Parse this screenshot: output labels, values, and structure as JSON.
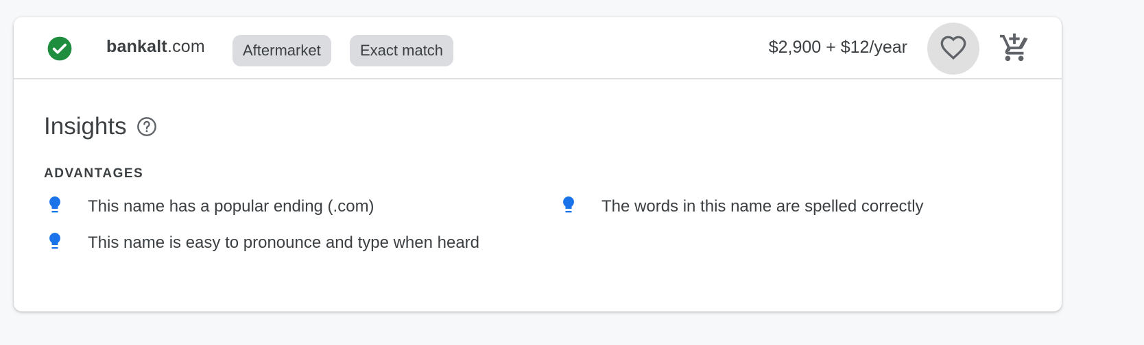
{
  "result": {
    "status": "available",
    "domain_sld": "bankalt",
    "domain_tld": ".com",
    "chips": [
      "Aftermarket",
      "Exact match"
    ],
    "price": "$2,900 + $12/year",
    "favorite_icon": "heart-outline-icon",
    "cart_icon": "add-shopping-cart-icon"
  },
  "insights": {
    "title": "Insights",
    "help_icon": "help-circle-icon",
    "section_label": "ADVANTAGES",
    "advantages": [
      "This name has a popular ending (.com)",
      "This name is easy to pronounce and type when heard",
      "The words in this name are spelled correctly"
    ]
  },
  "colors": {
    "status_green": "#1e8e3e",
    "bulb_blue": "#1a73e8",
    "chip_bg": "#dadce0",
    "icon_grey": "#5f6368"
  }
}
